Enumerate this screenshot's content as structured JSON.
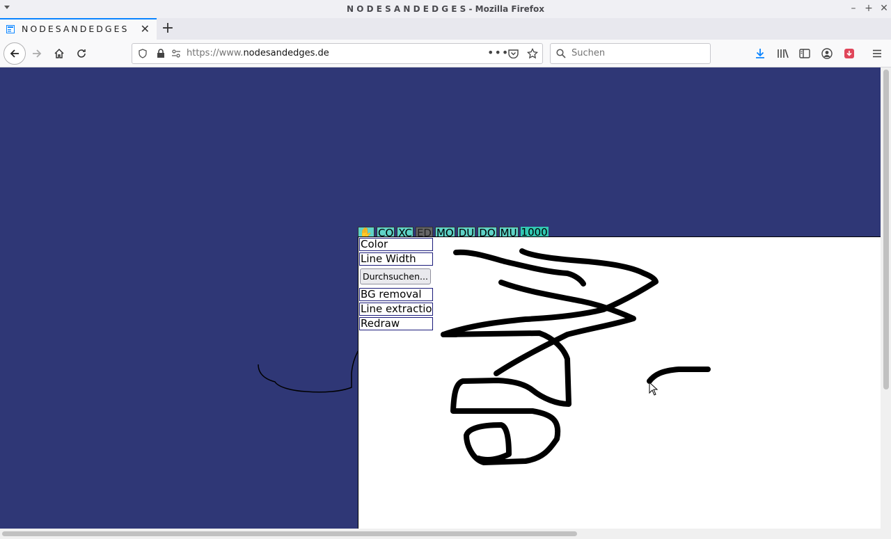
{
  "window": {
    "title": "N O D E S A N D E D G E S - Mozilla Firefox"
  },
  "tab": {
    "label": "NODESANDEDGES",
    "favicon": "page-icon"
  },
  "navbar": {
    "url_prefix": "https://www.",
    "url_host": "nodesandedges.de",
    "search_placeholder": "Suchen"
  },
  "app": {
    "toolbar": [
      {
        "label": "✋",
        "name": "hand-tool-button",
        "active": false
      },
      {
        "label": "CO",
        "name": "co-button",
        "active": false
      },
      {
        "label": "XC",
        "name": "xc-button",
        "active": false
      },
      {
        "label": "ED",
        "name": "ed-button",
        "active": true
      },
      {
        "label": "MO",
        "name": "mo-button",
        "active": false
      },
      {
        "label": "DU",
        "name": "du-button",
        "active": false
      },
      {
        "label": "DO",
        "name": "do-button",
        "active": false
      },
      {
        "label": "MU",
        "name": "mu-button",
        "active": false
      }
    ],
    "counter": "1000",
    "panel": {
      "color": "Color",
      "line_width": "Line Width",
      "file_button": "Durchsuchen...",
      "bg_removal": "BG removal",
      "line_extraction": "Line extraction",
      "redraw": "Redraw"
    }
  },
  "colors": {
    "background": "#2f3776",
    "toolbar_accent": "#5fd3c7",
    "counter_bg": "#32c8b2",
    "firefox_blue": "#0a84ff"
  }
}
